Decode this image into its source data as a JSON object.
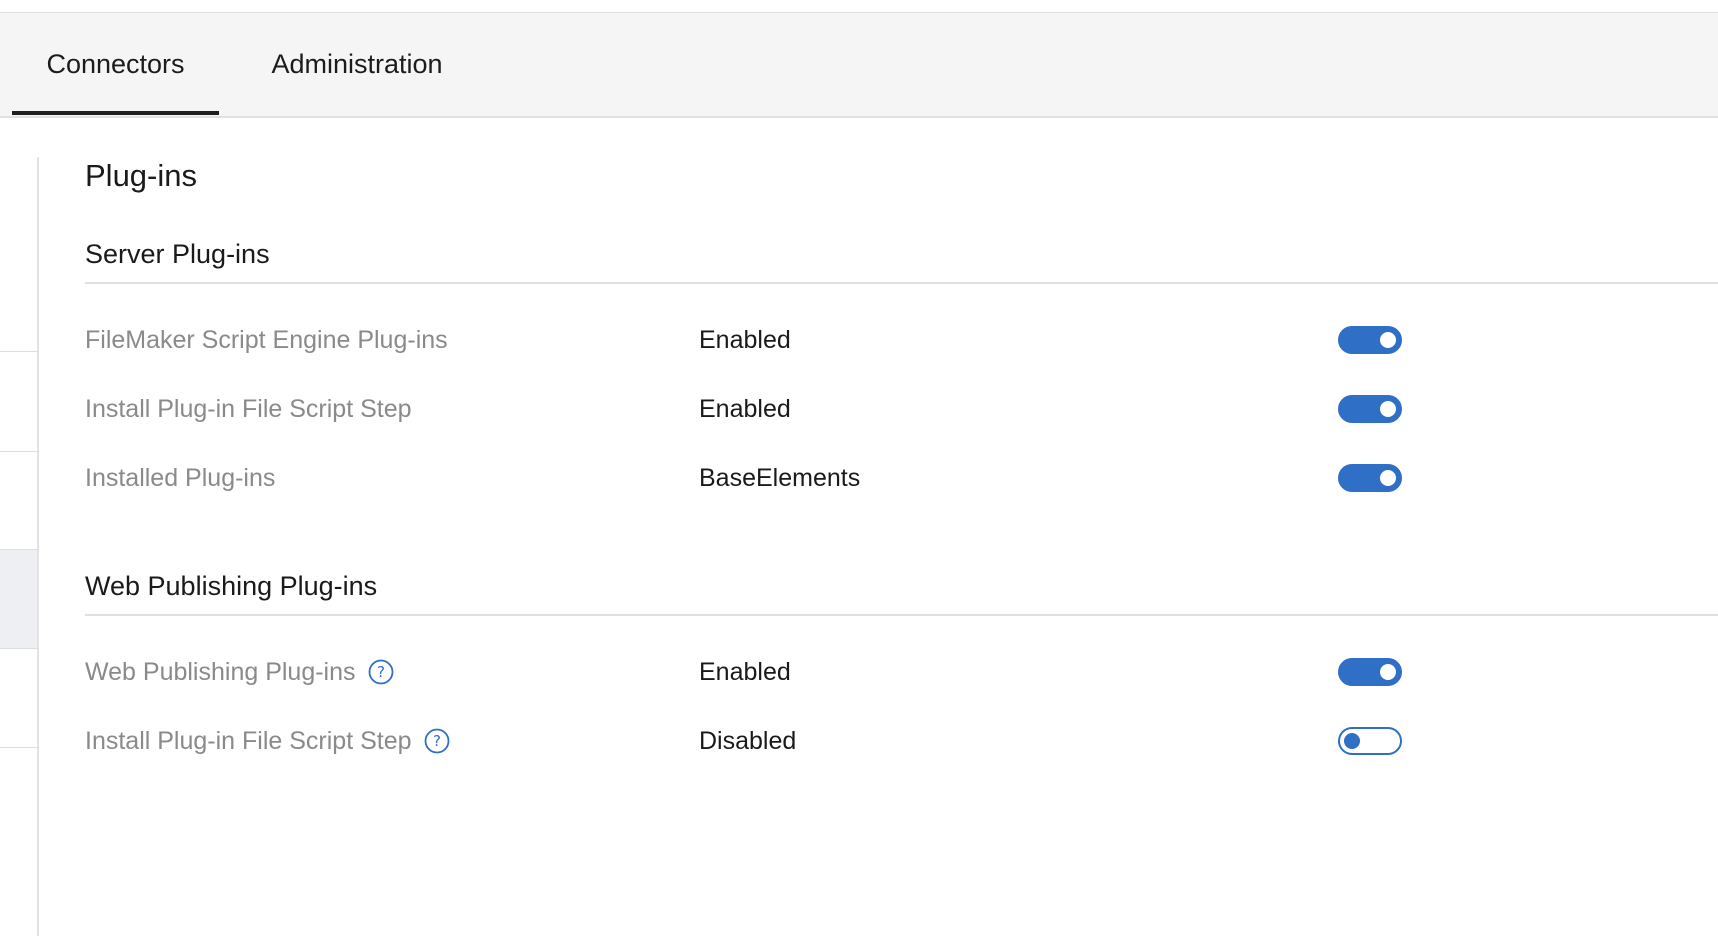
{
  "tabs": [
    {
      "label": "Connectors",
      "active": true
    },
    {
      "label": "Administration",
      "active": false
    }
  ],
  "page": {
    "title": "Plug-ins"
  },
  "sections": {
    "server": {
      "title": "Server Plug-ins",
      "rows": [
        {
          "label": "FileMaker Script Engine Plug-ins",
          "value": "Enabled",
          "toggle": "on",
          "help": false
        },
        {
          "label": "Install Plug-in File Script Step",
          "value": "Enabled",
          "toggle": "on",
          "help": false
        },
        {
          "label": "Installed Plug-ins",
          "value": "BaseElements",
          "toggle": "on",
          "help": false
        }
      ]
    },
    "web": {
      "title": "Web Publishing Plug-ins",
      "rows": [
        {
          "label": "Web Publishing Plug-ins",
          "value": "Enabled",
          "toggle": "on",
          "help": true
        },
        {
          "label": "Install Plug-in File Script Step",
          "value": "Disabled",
          "toggle": "off",
          "help": true
        }
      ]
    }
  },
  "icons": {
    "help": "help-circle-icon"
  },
  "colors": {
    "accent": "#2f6fc6",
    "tab_bar_bg": "#f5f5f5",
    "label_gray": "#8a8a8a",
    "active_tab_underline": "#1f1f1f"
  }
}
